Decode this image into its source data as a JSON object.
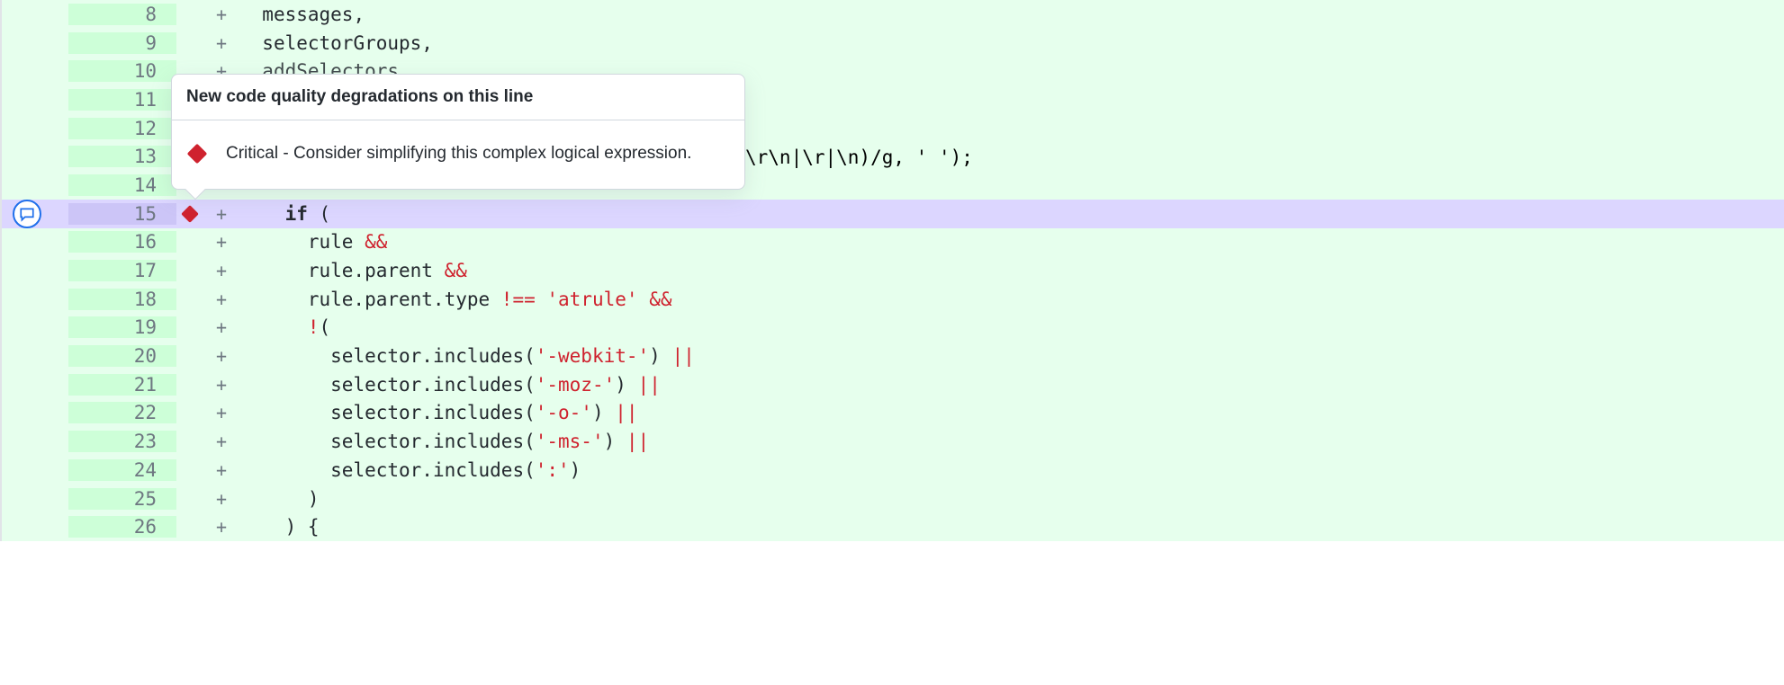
{
  "tooltip": {
    "title": "New code quality degradations on this line",
    "severity": "Critical",
    "message": "Consider simplifying this complex logical expression."
  },
  "partial_code_after_tooltip": {
    "regex_tail": "\\r\\n|\\r|\\n)/g",
    "comma": ", ",
    "space_literal": "' '",
    "close": ");"
  },
  "rows": [
    {
      "num": "8",
      "sign": "+",
      "indent": "  ",
      "seg": [
        {
          "t": "messages,",
          "c": ""
        }
      ]
    },
    {
      "num": "9",
      "sign": "+",
      "indent": "  ",
      "seg": [
        {
          "t": "selectorGroups,",
          "c": ""
        }
      ]
    },
    {
      "num": "10",
      "sign": "+",
      "indent": "  ",
      "seg": [
        {
          "t": "addSelectors",
          "c": ""
        }
      ],
      "faded": true
    },
    {
      "num": "11",
      "sign": "",
      "indent": "",
      "seg": []
    },
    {
      "num": "12",
      "sign": "",
      "indent": "",
      "seg": []
    },
    {
      "num": "13",
      "sign": "",
      "indent": "",
      "seg": []
    },
    {
      "num": "14",
      "sign": "",
      "indent": "",
      "seg": []
    },
    {
      "num": "15",
      "sign": "+",
      "indent": "    ",
      "seg": [
        {
          "t": "if",
          "c": "kw"
        },
        {
          "t": " (",
          "c": ""
        }
      ],
      "highlighted": true,
      "marker": true,
      "comment": true
    },
    {
      "num": "16",
      "sign": "+",
      "indent": "      ",
      "seg": [
        {
          "t": "rule ",
          "c": ""
        },
        {
          "t": "&&",
          "c": "op"
        }
      ]
    },
    {
      "num": "17",
      "sign": "+",
      "indent": "      ",
      "seg": [
        {
          "t": "rule.parent ",
          "c": ""
        },
        {
          "t": "&&",
          "c": "op"
        }
      ]
    },
    {
      "num": "18",
      "sign": "+",
      "indent": "      ",
      "seg": [
        {
          "t": "rule.parent.type ",
          "c": ""
        },
        {
          "t": "!==",
          "c": "op"
        },
        {
          "t": " ",
          "c": ""
        },
        {
          "t": "'atrule'",
          "c": "str"
        },
        {
          "t": " ",
          "c": ""
        },
        {
          "t": "&&",
          "c": "op"
        }
      ]
    },
    {
      "num": "19",
      "sign": "+",
      "indent": "      ",
      "seg": [
        {
          "t": "!",
          "c": "op"
        },
        {
          "t": "(",
          "c": ""
        }
      ]
    },
    {
      "num": "20",
      "sign": "+",
      "indent": "        ",
      "seg": [
        {
          "t": "selector.includes(",
          "c": ""
        },
        {
          "t": "'-webkit-'",
          "c": "str"
        },
        {
          "t": ") ",
          "c": ""
        },
        {
          "t": "||",
          "c": "op"
        }
      ]
    },
    {
      "num": "21",
      "sign": "+",
      "indent": "        ",
      "seg": [
        {
          "t": "selector.includes(",
          "c": ""
        },
        {
          "t": "'-moz-'",
          "c": "str"
        },
        {
          "t": ") ",
          "c": ""
        },
        {
          "t": "||",
          "c": "op"
        }
      ]
    },
    {
      "num": "22",
      "sign": "+",
      "indent": "        ",
      "seg": [
        {
          "t": "selector.includes(",
          "c": ""
        },
        {
          "t": "'-o-'",
          "c": "str"
        },
        {
          "t": ") ",
          "c": ""
        },
        {
          "t": "||",
          "c": "op"
        }
      ]
    },
    {
      "num": "23",
      "sign": "+",
      "indent": "        ",
      "seg": [
        {
          "t": "selector.includes(",
          "c": ""
        },
        {
          "t": "'-ms-'",
          "c": "str"
        },
        {
          "t": ") ",
          "c": ""
        },
        {
          "t": "||",
          "c": "op"
        }
      ]
    },
    {
      "num": "24",
      "sign": "+",
      "indent": "        ",
      "seg": [
        {
          "t": "selector.includes(",
          "c": ""
        },
        {
          "t": "':'",
          "c": "str"
        },
        {
          "t": ")",
          "c": ""
        }
      ]
    },
    {
      "num": "25",
      "sign": "+",
      "indent": "      ",
      "seg": [
        {
          "t": ")",
          "c": ""
        }
      ]
    },
    {
      "num": "26",
      "sign": "+",
      "indent": "    ",
      "seg": [
        {
          "t": ") {",
          "c": ""
        }
      ]
    }
  ]
}
